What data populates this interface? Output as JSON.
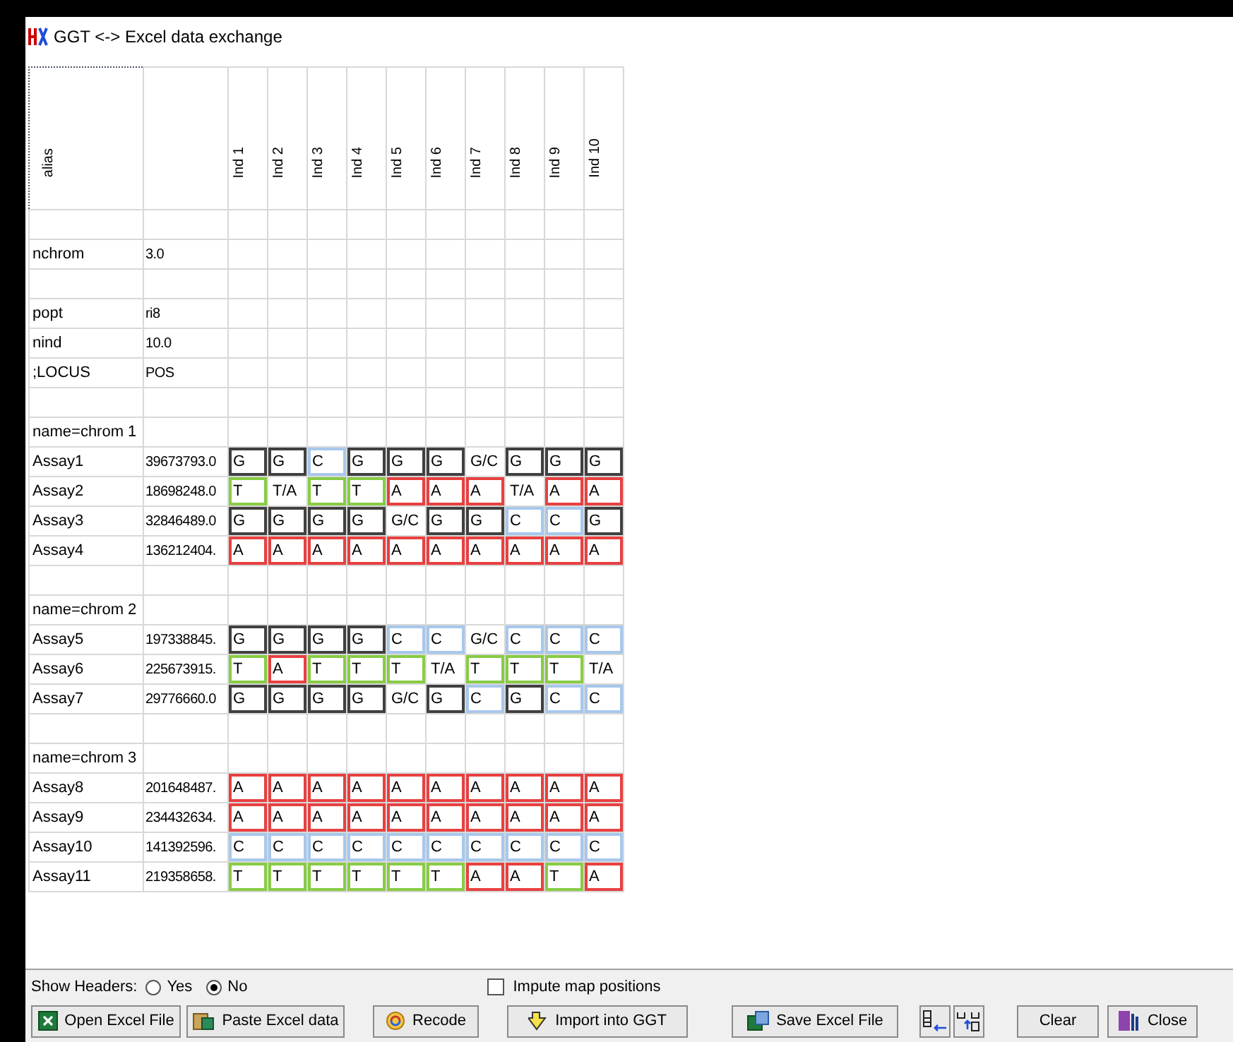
{
  "window": {
    "title": "GGT <-> Excel data exchange"
  },
  "grid": {
    "alias_header": "alias",
    "columns": [
      "Ind 1",
      "Ind 2",
      "Ind 3",
      "Ind 4",
      "Ind 5",
      "Ind 6",
      "Ind 7",
      "Ind 8",
      "Ind 9",
      "Ind 10"
    ],
    "rows": [
      {
        "kind": "blank"
      },
      {
        "kind": "info",
        "name": "nchrom",
        "value": "3.0"
      },
      {
        "kind": "blank"
      },
      {
        "kind": "info",
        "name": "popt",
        "value": "ri8"
      },
      {
        "kind": "info",
        "name": "nind",
        "value": "10.0"
      },
      {
        "kind": "info",
        "name": ";LOCUS",
        "value": "POS"
      },
      {
        "kind": "blank"
      },
      {
        "kind": "info",
        "name": "name=chrom 1"
      },
      {
        "kind": "assay",
        "name": "Assay1",
        "value": "39673793.0",
        "genotypes": [
          {
            "text": "G",
            "color": "#404040"
          },
          {
            "text": "G",
            "color": "#404040"
          },
          {
            "text": "C",
            "color": "#a8c8ec"
          },
          {
            "text": "G",
            "color": "#404040"
          },
          {
            "text": "G",
            "color": "#404040"
          },
          {
            "text": "G",
            "color": "#404040"
          },
          {
            "text": "G/C"
          },
          {
            "text": "G",
            "color": "#404040"
          },
          {
            "text": "G",
            "color": "#404040"
          },
          {
            "text": "G",
            "color": "#404040"
          }
        ]
      },
      {
        "kind": "assay",
        "name": "Assay2",
        "value": "18698248.0",
        "genotypes": [
          {
            "text": "T",
            "color": "#88cc44"
          },
          {
            "text": "T/A"
          },
          {
            "text": "T",
            "color": "#88cc44"
          },
          {
            "text": "T",
            "color": "#88cc44"
          },
          {
            "text": "A",
            "color": "#e84040"
          },
          {
            "text": "A",
            "color": "#e84040"
          },
          {
            "text": "A",
            "color": "#e84040"
          },
          {
            "text": "T/A"
          },
          {
            "text": "A",
            "color": "#e84040"
          },
          {
            "text": "A",
            "color": "#e84040"
          }
        ]
      },
      {
        "kind": "assay",
        "name": "Assay3",
        "value": "32846489.0",
        "genotypes": [
          {
            "text": "G",
            "color": "#404040"
          },
          {
            "text": "G",
            "color": "#404040"
          },
          {
            "text": "G",
            "color": "#404040"
          },
          {
            "text": "G",
            "color": "#404040"
          },
          {
            "text": "G/C"
          },
          {
            "text": "G",
            "color": "#404040"
          },
          {
            "text": "G",
            "color": "#404040"
          },
          {
            "text": "C",
            "color": "#a8c8ec"
          },
          {
            "text": "C",
            "color": "#a8c8ec"
          },
          {
            "text": "G",
            "color": "#404040"
          }
        ]
      },
      {
        "kind": "assay",
        "name": "Assay4",
        "value": "136212404.",
        "genotypes": [
          {
            "text": "A",
            "color": "#e84040"
          },
          {
            "text": "A",
            "color": "#e84040"
          },
          {
            "text": "A",
            "color": "#e84040"
          },
          {
            "text": "A",
            "color": "#e84040"
          },
          {
            "text": "A",
            "color": "#e84040"
          },
          {
            "text": "A",
            "color": "#e84040"
          },
          {
            "text": "A",
            "color": "#e84040"
          },
          {
            "text": "A",
            "color": "#e84040"
          },
          {
            "text": "A",
            "color": "#e84040"
          },
          {
            "text": "A",
            "color": "#e84040"
          }
        ]
      },
      {
        "kind": "blank"
      },
      {
        "kind": "info",
        "name": "name=chrom 2"
      },
      {
        "kind": "assay",
        "name": "Assay5",
        "value": "197338845.",
        "genotypes": [
          {
            "text": "G",
            "color": "#404040"
          },
          {
            "text": "G",
            "color": "#404040"
          },
          {
            "text": "G",
            "color": "#404040"
          },
          {
            "text": "G",
            "color": "#404040"
          },
          {
            "text": "C",
            "color": "#a8c8ec"
          },
          {
            "text": "C",
            "color": "#a8c8ec"
          },
          {
            "text": "G/C"
          },
          {
            "text": "C",
            "color": "#a8c8ec"
          },
          {
            "text": "C",
            "color": "#a8c8ec"
          },
          {
            "text": "C",
            "color": "#a8c8ec"
          }
        ]
      },
      {
        "kind": "assay",
        "name": "Assay6",
        "value": "225673915.",
        "genotypes": [
          {
            "text": "T",
            "color": "#88cc44"
          },
          {
            "text": "A",
            "color": "#e84040"
          },
          {
            "text": "T",
            "color": "#88cc44"
          },
          {
            "text": "T",
            "color": "#88cc44"
          },
          {
            "text": "T",
            "color": "#88cc44"
          },
          {
            "text": "T/A"
          },
          {
            "text": "T",
            "color": "#88cc44"
          },
          {
            "text": "T",
            "color": "#88cc44"
          },
          {
            "text": "T",
            "color": "#88cc44"
          },
          {
            "text": "T/A"
          }
        ]
      },
      {
        "kind": "assay",
        "name": "Assay7",
        "value": "29776660.0",
        "genotypes": [
          {
            "text": "G",
            "color": "#404040"
          },
          {
            "text": "G",
            "color": "#404040"
          },
          {
            "text": "G",
            "color": "#404040"
          },
          {
            "text": "G",
            "color": "#404040"
          },
          {
            "text": "G/C"
          },
          {
            "text": "G",
            "color": "#404040"
          },
          {
            "text": "C",
            "color": "#a8c8ec"
          },
          {
            "text": "G",
            "color": "#404040"
          },
          {
            "text": "C",
            "color": "#a8c8ec"
          },
          {
            "text": "C",
            "color": "#a8c8ec"
          }
        ]
      },
      {
        "kind": "blank"
      },
      {
        "kind": "info",
        "name": "name=chrom 3"
      },
      {
        "kind": "assay",
        "name": "Assay8",
        "value": "201648487.",
        "genotypes": [
          {
            "text": "A",
            "color": "#e84040"
          },
          {
            "text": "A",
            "color": "#e84040"
          },
          {
            "text": "A",
            "color": "#e84040"
          },
          {
            "text": "A",
            "color": "#e84040"
          },
          {
            "text": "A",
            "color": "#e84040"
          },
          {
            "text": "A",
            "color": "#e84040"
          },
          {
            "text": "A",
            "color": "#e84040"
          },
          {
            "text": "A",
            "color": "#e84040"
          },
          {
            "text": "A",
            "color": "#e84040"
          },
          {
            "text": "A",
            "color": "#e84040"
          }
        ]
      },
      {
        "kind": "assay",
        "name": "Assay9",
        "value": "234432634.",
        "genotypes": [
          {
            "text": "A",
            "color": "#e84040"
          },
          {
            "text": "A",
            "color": "#e84040"
          },
          {
            "text": "A",
            "color": "#e84040"
          },
          {
            "text": "A",
            "color": "#e84040"
          },
          {
            "text": "A",
            "color": "#e84040"
          },
          {
            "text": "A",
            "color": "#e84040"
          },
          {
            "text": "A",
            "color": "#e84040"
          },
          {
            "text": "A",
            "color": "#e84040"
          },
          {
            "text": "A",
            "color": "#e84040"
          },
          {
            "text": "A",
            "color": "#e84040"
          }
        ]
      },
      {
        "kind": "assay",
        "name": "Assay10",
        "value": "141392596.",
        "genotypes": [
          {
            "text": "C",
            "color": "#a8c8ec"
          },
          {
            "text": "C",
            "color": "#a8c8ec"
          },
          {
            "text": "C",
            "color": "#a8c8ec"
          },
          {
            "text": "C",
            "color": "#a8c8ec"
          },
          {
            "text": "C",
            "color": "#a8c8ec"
          },
          {
            "text": "C",
            "color": "#a8c8ec"
          },
          {
            "text": "C",
            "color": "#a8c8ec"
          },
          {
            "text": "C",
            "color": "#a8c8ec"
          },
          {
            "text": "C",
            "color": "#a8c8ec"
          },
          {
            "text": "C",
            "color": "#a8c8ec"
          }
        ]
      },
      {
        "kind": "assay",
        "name": "Assay11",
        "value": "219358658.",
        "genotypes": [
          {
            "text": "T",
            "color": "#88cc44"
          },
          {
            "text": "T",
            "color": "#88cc44"
          },
          {
            "text": "T",
            "color": "#88cc44"
          },
          {
            "text": "T",
            "color": "#88cc44"
          },
          {
            "text": "T",
            "color": "#88cc44"
          },
          {
            "text": "T",
            "color": "#88cc44"
          },
          {
            "text": "A",
            "color": "#e84040"
          },
          {
            "text": "A",
            "color": "#e84040"
          },
          {
            "text": "T",
            "color": "#88cc44"
          },
          {
            "text": "A",
            "color": "#e84040"
          }
        ]
      }
    ]
  },
  "show_headers": {
    "label": "Show Headers:",
    "options": [
      {
        "label": "Yes",
        "selected": false
      },
      {
        "label": "No",
        "selected": true
      }
    ]
  },
  "impute": {
    "label": "Impute map positions",
    "checked": false
  },
  "buttons": [
    {
      "kind": "excel",
      "label": "Open Excel File"
    },
    {
      "kind": "paste",
      "label": "Paste Excel data"
    },
    {
      "kind": "recode",
      "label": "Recode"
    },
    {
      "kind": "import",
      "label": "Import into GGT"
    },
    {
      "kind": "save",
      "label": "Save Excel File"
    },
    {
      "kind": "left"
    },
    {
      "kind": "right"
    },
    {
      "kind": "plain",
      "label": "Clear"
    },
    {
      "kind": "close",
      "label": "Close"
    }
  ]
}
